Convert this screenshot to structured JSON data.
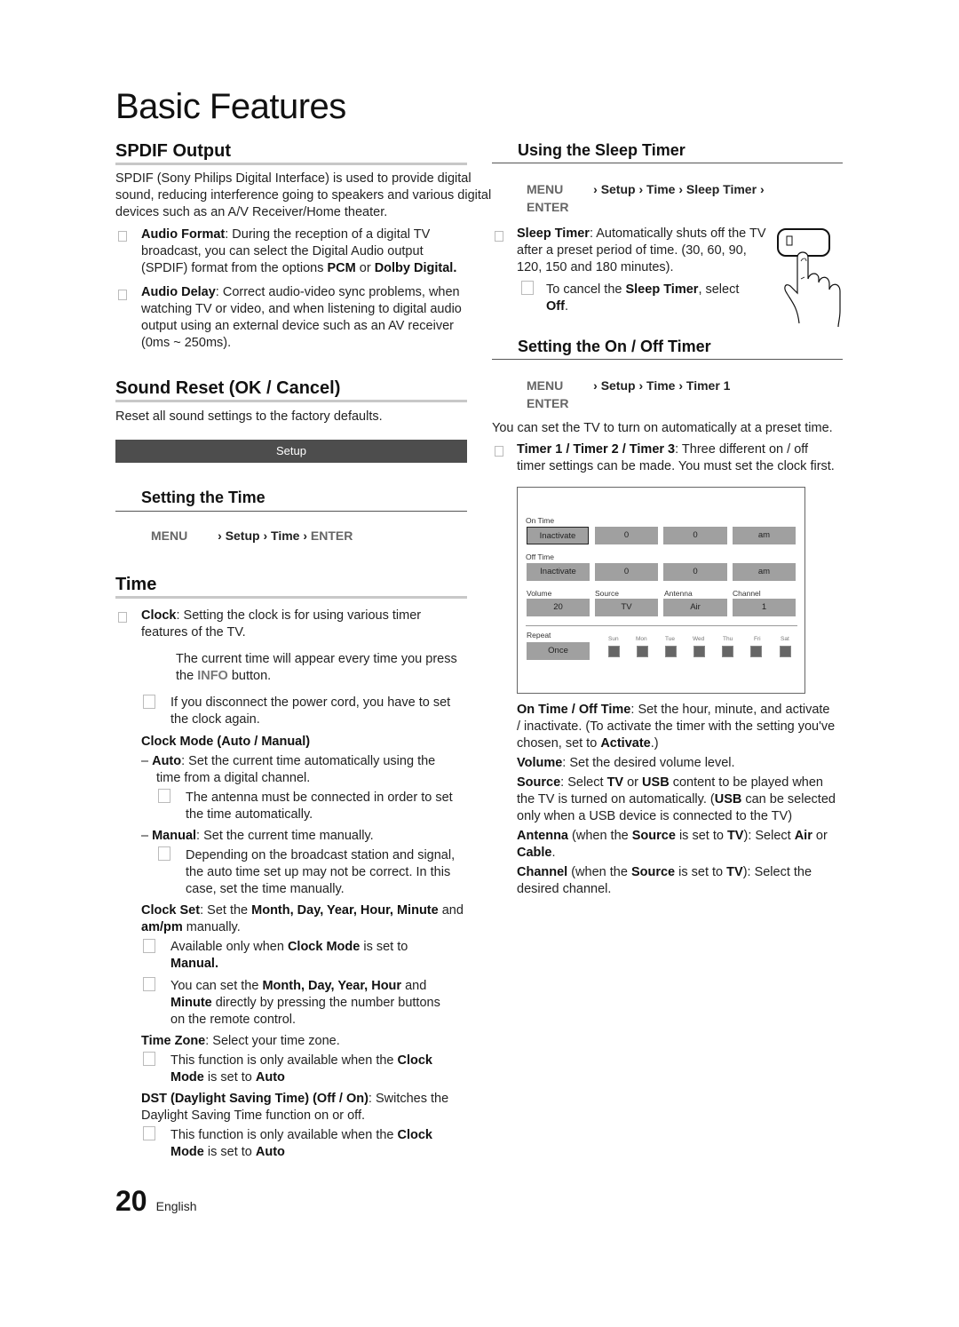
{
  "page": {
    "title": "Basic Features",
    "page_number": "20",
    "language": "English"
  },
  "left": {
    "spdif": {
      "heading": "SPDIF Output",
      "intro": "SPDIF (Sony Philips Digital Interface) is used to provide digital sound, reducing interference going to speakers and various digital devices such as an A/V Receiver/Home theater.",
      "items": [
        {
          "term": "Audio Format",
          "lines": [
            "Audio Format: During the reception of a digital TV",
            "broadcast, you can select the Digital Audio output",
            "(SPDIF) format from the options PCM or Dolby Digital."
          ]
        },
        {
          "term": "Audio Delay",
          "lines": [
            "Audio Delay: Correct audio-video sync problems, when",
            "watching TV or video, and when listening to digital audio",
            "output using an external device such as an AV receiver",
            "(0ms ~ 250ms)."
          ]
        }
      ],
      "audio_format_label": "Audio Format",
      "audio_format_rest1": ": During the reception of a digital TV",
      "audio_format_rest2": "broadcast, you can select the Digital Audio output",
      "audio_format_rest3a": "(SPDIF) format from the options ",
      "pcm": "PCM",
      "or": " or ",
      "dolby": "Dolby Digital",
      "period": ".",
      "audio_delay_label": "Audio Delay",
      "audio_delay_rest1": ": Correct audio-video sync problems, when",
      "audio_delay_rest2": "watching TV or video, and when listening to digital audio",
      "audio_delay_rest3": "output using an external device such as an AV receiver",
      "audio_delay_rest4": "(0ms ~ 250ms)."
    },
    "sound_reset": {
      "heading": "Sound Reset (OK / Cancel)",
      "text": "Reset all sound settings to the factory defaults."
    },
    "setup_bar": {
      "label": "Setup"
    },
    "setting_time": {
      "heading": "Setting the Time",
      "menu_path": [
        "MENU",
        "Setup",
        "Time",
        "ENTER"
      ]
    },
    "time": {
      "heading": "Time",
      "clock_label": "Clock",
      "clock_rest1": ": Setting the clock is for using various timer",
      "clock_rest2": "features of the TV.",
      "info_line1": "The current time will appear every time you press",
      "info_line2a": "the ",
      "info_btn": "INFO",
      "info_line2b": " button.",
      "note_power_1": "If you disconnect the power cord, you have to set",
      "note_power_2": "the clock again.",
      "clock_mode_heading": "Clock Mode (Auto / Manual)",
      "auto_label": "Auto",
      "auto_rest1": ": Set the current time automatically using the",
      "auto_rest2": "time from a digital channel.",
      "auto_note1": "The antenna must be connected in order to set",
      "auto_note2": "the time automatically.",
      "manual_label": "Manual",
      "manual_rest": ": Set the current time manually.",
      "manual_note1": "Depending on the broadcast station and signal,",
      "manual_note2": "the auto time set up may not be correct. In this",
      "manual_note3": "case, set the time manually.",
      "clock_set_label": "Clock Set",
      "clock_set_rest1a": ": Set the ",
      "clock_set_fields": "Month, Day, Year, Hour, Minute",
      "clock_set_rest1b": " and",
      "clock_set_ampm": "am/pm",
      "clock_set_rest2": " manually.",
      "cs_note1a": "Available only when ",
      "cs_note1b": "Clock Mode",
      "cs_note1c": " is set to",
      "cs_note1d": "Manual.",
      "cs_note2a": "You can set the ",
      "cs_note2b": "Month, Day, Year, Hour",
      "cs_note2c": " and",
      "cs_note2d": "Minute",
      "cs_note2e": " directly by pressing the number buttons",
      "cs_note2f": "on the remote control.",
      "tz_label": "Time Zone",
      "tz_rest": ": Select your time zone.",
      "tz_note_a": "This function is only available when the ",
      "tz_note_b": "Clock",
      "tz_note_c": "Mode",
      "tz_note_d": " is set to ",
      "tz_note_e": "Auto",
      "dst_label": "DST (Daylight Saving Time) (Off / On)",
      "dst_rest1": ": Switches the",
      "dst_rest2": "Daylight Saving Time function on or off.",
      "dst_note_a": "This function is only available when the ",
      "dst_note_b": "Clock",
      "dst_note_c": "Mode",
      "dst_note_d": " is set to ",
      "dst_note_e": "Auto"
    }
  },
  "right": {
    "sleep": {
      "heading": "Using the Sleep Timer",
      "menu_path": [
        "MENU",
        "Setup",
        "Time",
        "Sleep Timer",
        "ENTER"
      ],
      "label": "Sleep Timer",
      "rest1": ": Automatically shuts off the TV",
      "rest2": "after a preset period of time. (30, 60, 90,",
      "rest3": "120, 150 and 180 minutes).",
      "note_a": "To cancel the ",
      "note_b": "Sleep Timer",
      "note_c": ", select",
      "note_d": "Off",
      "note_e": "."
    },
    "onoff": {
      "heading": "Setting the On / Off Timer",
      "menu_path": [
        "MENU",
        "Setup",
        "Time",
        "Timer 1",
        "ENTER"
      ],
      "intro": "You can set the TV to turn on automatically at a preset time.",
      "timers_label": "Timer 1 / Timer 2 / Timer 3",
      "timers_rest1": ": Three different on / off",
      "timers_rest2": "timer settings can be made. You must set the clock first."
    },
    "panel": {
      "on_time_label": "On Time",
      "on_time": [
        "Inactivate",
        "0",
        "0",
        "am"
      ],
      "off_time_label": "Off Time",
      "off_time": [
        "Inactivate",
        "0",
        "0",
        "am"
      ],
      "volume_label": "Volume",
      "volume": "20",
      "source_label": "Source",
      "source": "TV",
      "antenna_label": "Antenna",
      "antenna": "Air",
      "channel_label": "Channel",
      "channel": "1",
      "repeat_label": "Repeat",
      "repeat": "Once",
      "days": [
        "Sun",
        "Mon",
        "Tue",
        "Wed",
        "Thu",
        "Fri",
        "Sat"
      ]
    },
    "desc": {
      "onoff_label": "On Time / Off Time",
      "onoff_rest1": ": Set the hour, minute, and activate",
      "onoff_rest2": "/ inactivate. (To activate the timer with the setting you've",
      "onoff_rest3a": "chosen, set to ",
      "activate": "Activate",
      "onoff_rest3b": ".)",
      "volume_label": "Volume",
      "volume_rest": ": Set the desired volume level.",
      "source_label": "Source",
      "source_rest1a": ": Select ",
      "tv": "TV",
      "source_rest1b": " or ",
      "usb": "USB",
      "source_rest1c": " content to be played when",
      "source_rest2a": "the TV is turned on automatically. (",
      "source_rest2b": " can be selected",
      "source_rest3": "only when a USB device is connected to the TV)",
      "antenna_label": "Antenna",
      "antenna_rest1a": " (when the ",
      "source_word": "Source",
      "antenna_rest1b": " is set to ",
      "antenna_rest1c": "): Select ",
      "air": "Air",
      "antenna_rest1d": " or",
      "cable": "Cable",
      "channel_label": "Channel",
      "channel_rest1c": "): Select the",
      "channel_rest2": "desired channel."
    }
  }
}
